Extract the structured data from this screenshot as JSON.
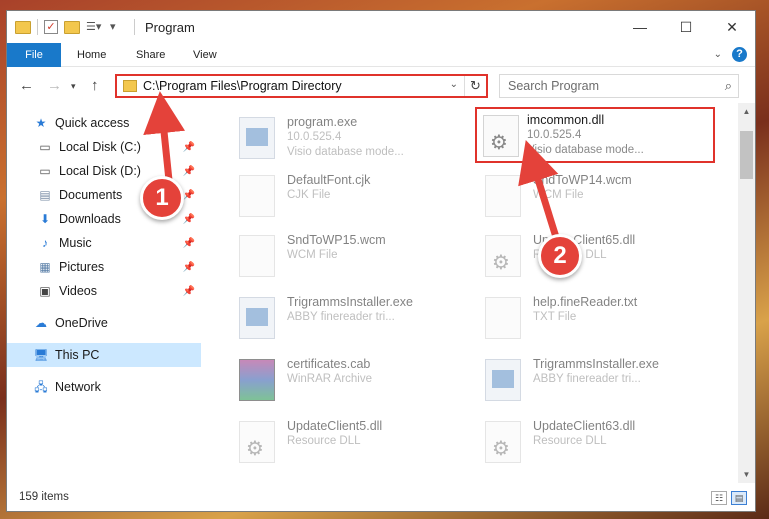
{
  "window": {
    "title": "Program",
    "buttons": {
      "minimize": "—",
      "maximize": "☐",
      "close": "✕"
    }
  },
  "ribbon": {
    "tabs": [
      "File",
      "Home",
      "Share",
      "View"
    ],
    "help": "?"
  },
  "address": {
    "path": "C:\\Program Files\\Program Directory",
    "search_placeholder": "Search Program"
  },
  "sidebar": {
    "items": [
      {
        "label": "Quick access",
        "icon": "star-icon"
      },
      {
        "label": "Local Disk (C:)",
        "icon": "drive-icon"
      },
      {
        "label": "Local Disk (D:)",
        "icon": "drive-icon"
      },
      {
        "label": "Documents",
        "icon": "documents-icon"
      },
      {
        "label": "Downloads",
        "icon": "download-icon"
      },
      {
        "label": "Music",
        "icon": "music-icon"
      },
      {
        "label": "Pictures",
        "icon": "pictures-icon"
      },
      {
        "label": "Videos",
        "icon": "videos-icon"
      },
      {
        "label": "OneDrive",
        "icon": "cloud-icon"
      },
      {
        "label": "This PC",
        "icon": "computer-icon"
      },
      {
        "label": "Network",
        "icon": "network-icon"
      }
    ]
  },
  "files": [
    {
      "name": "program.exe",
      "line2": "10.0.525.4",
      "line3": "Visio database mode..."
    },
    {
      "name": "imcommon.dll",
      "line2": "10.0.525.4",
      "line3": "Visio database mode..."
    },
    {
      "name": "DefaultFont.cjk",
      "line2": "CJK File",
      "line3": ""
    },
    {
      "name": "SndToWP14.wcm",
      "line2": "WCM File",
      "line3": ""
    },
    {
      "name": "SndToWP15.wcm",
      "line2": "WCM File",
      "line3": ""
    },
    {
      "name": "UpdateClient65.dll",
      "line2": "Resource DLL",
      "line3": ""
    },
    {
      "name": "TrigrammsInstaller.exe",
      "line2": "ABBY finereader tri...",
      "line3": ""
    },
    {
      "name": "help.fineReader.txt",
      "line2": "TXT File",
      "line3": ""
    },
    {
      "name": "certificates.cab",
      "line2": "WinRAR Archive",
      "line3": ""
    },
    {
      "name": "TrigrammsInstaller.exe",
      "line2": "ABBY finereader tri...",
      "line3": ""
    },
    {
      "name": "UpdateClient5.dll",
      "line2": "Resource DLL",
      "line3": ""
    },
    {
      "name": "UpdateClient63.dll",
      "line2": "Resource DLL",
      "line3": ""
    }
  ],
  "status": {
    "items": "159 items"
  },
  "callouts": [
    "1",
    "2"
  ],
  "colors": {
    "accent": "#1979ca",
    "highlight": "#e0322b",
    "callout": "#e4423a"
  }
}
